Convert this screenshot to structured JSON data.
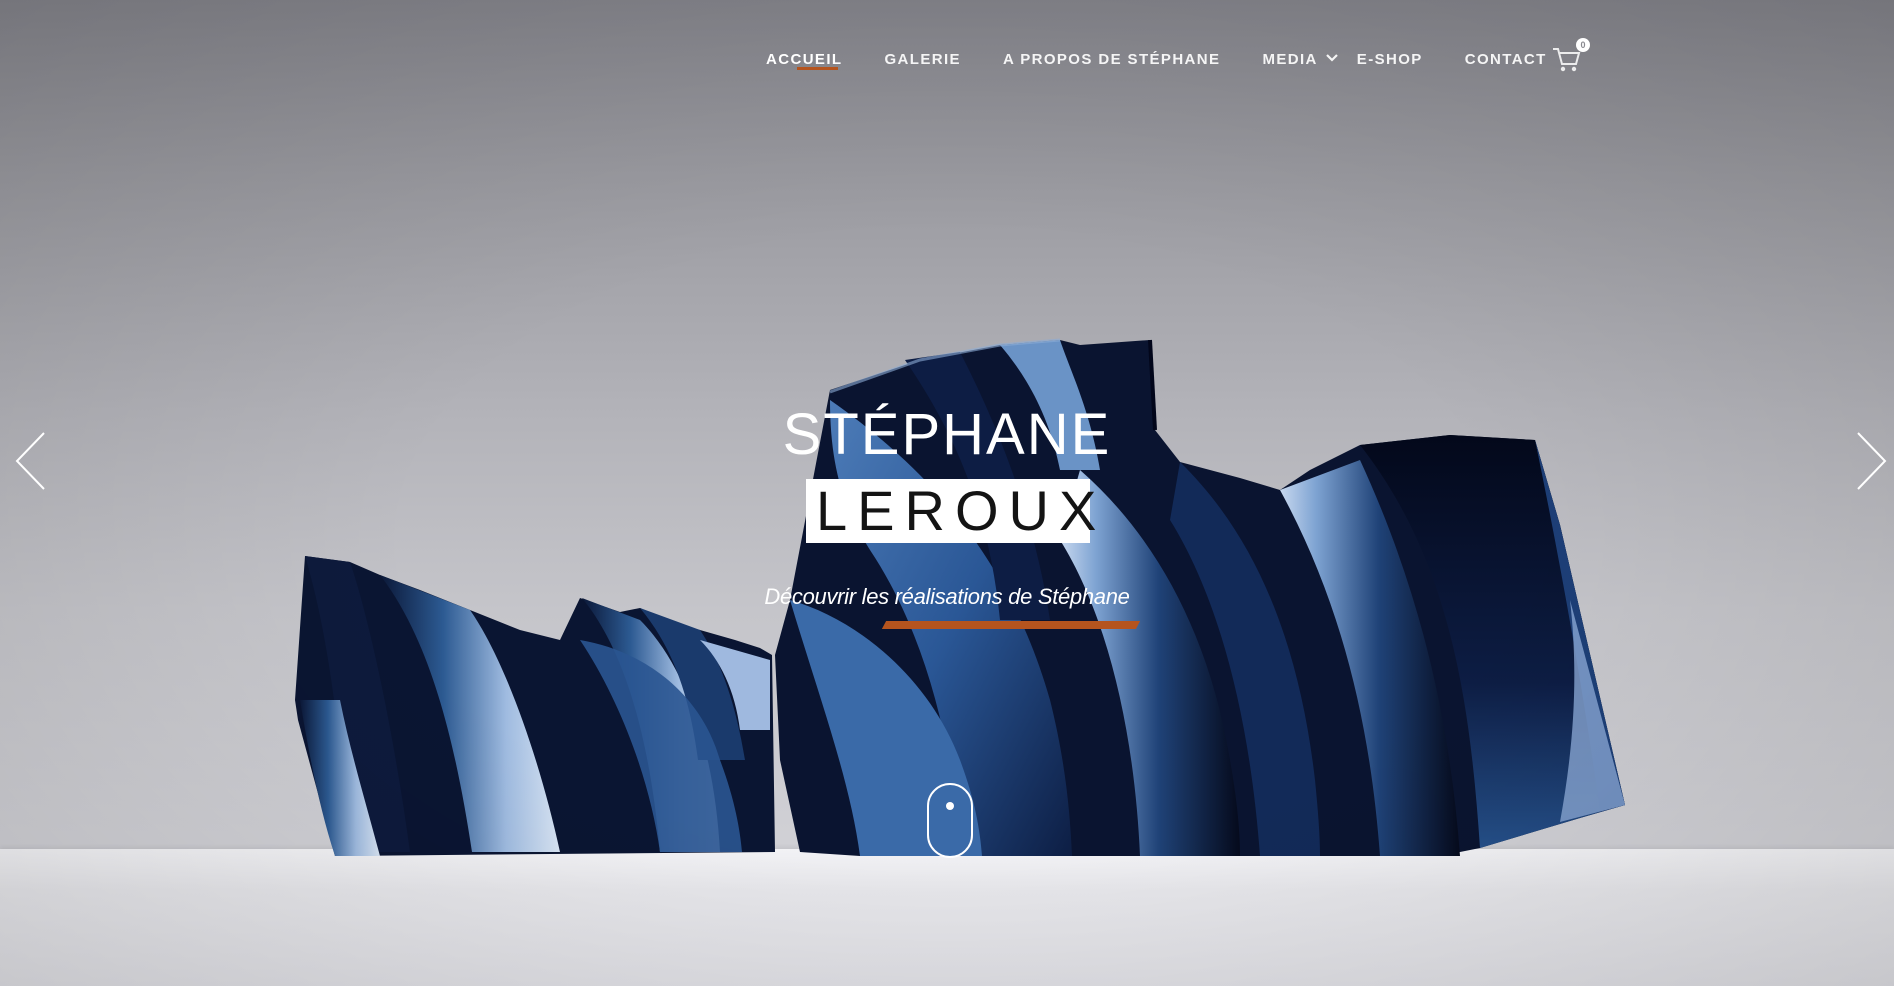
{
  "nav": {
    "items": [
      {
        "label": "ACCUEIL",
        "active": true
      },
      {
        "label": "GALERIE"
      },
      {
        "label": "A PROPOS DE STÉPHANE"
      },
      {
        "label": "MEDIA",
        "has_dropdown": true
      },
      {
        "label": "E-SHOP"
      },
      {
        "label": "CONTACT"
      }
    ],
    "cart": {
      "icon": "shopping-cart-icon",
      "count": "0"
    }
  },
  "hero": {
    "title_first": "STÉPHANE",
    "title_last": "LEROUX",
    "cta_label": "Découvrir les réalisations de Stéphane"
  },
  "slider": {
    "prev_icon": "chevron-left-icon",
    "next_icon": "chevron-right-icon",
    "scroll_icon": "mouse-scroll-icon"
  },
  "colors": {
    "accent": "#b5541e",
    "nav_text": "#ffffff",
    "sculpture_dark": "#08112a",
    "sculpture_mid": "#2b5c94",
    "sculpture_light": "#c5d6ee"
  }
}
